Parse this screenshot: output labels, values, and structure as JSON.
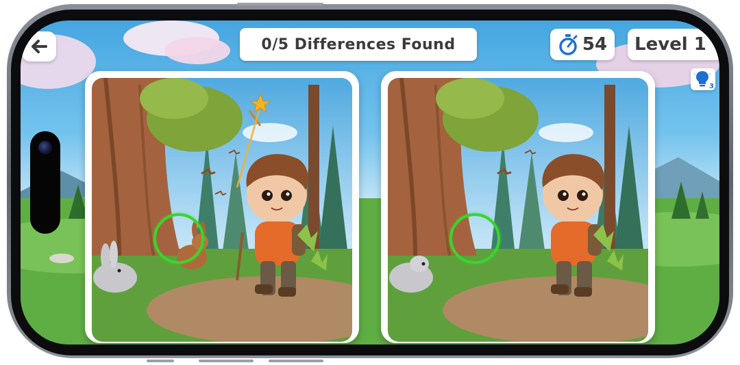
{
  "hud": {
    "back_icon": "arrow-left-icon",
    "differences_label": "0/5 Differences Found",
    "timer_icon": "stopwatch-icon",
    "timer_value": "54",
    "level_label": "Level 1",
    "hint_icon": "lightbulb-icon",
    "hint_count": "3"
  },
  "game": {
    "found": 0,
    "total": 5,
    "marked_differences": [
      "rabbit"
    ]
  },
  "colors": {
    "marker": "#39d62b",
    "hud_text": "#3b3b3b",
    "accent_blue": "#1f6fd1"
  }
}
